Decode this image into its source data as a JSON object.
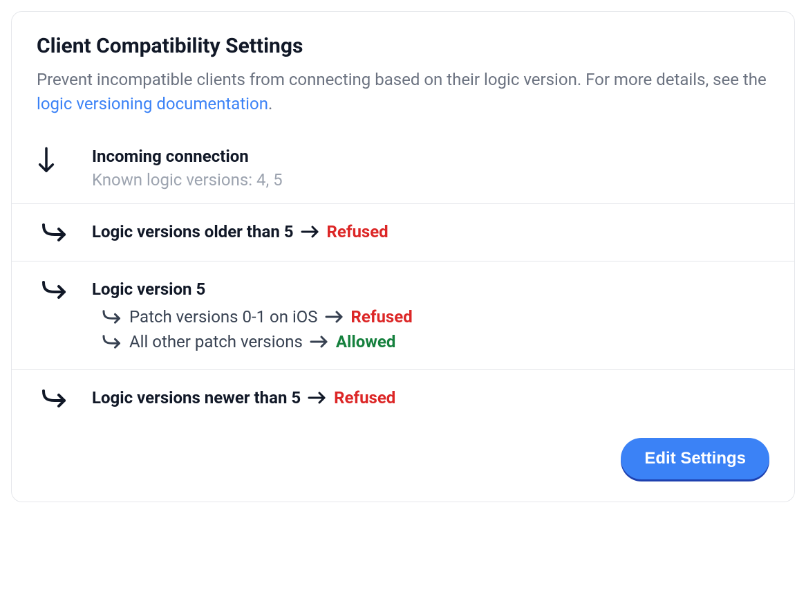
{
  "header": {
    "title": "Client Compatibility Settings",
    "description_prefix": "Prevent incompatible clients from connecting based on their logic version. For more details, see the ",
    "description_link": "logic versioning documentation",
    "description_suffix": "."
  },
  "incoming": {
    "title": "Incoming connection",
    "subtitle": "Known logic versions: 4, 5"
  },
  "rules": {
    "older": {
      "label": "Logic versions older than 5",
      "status": "Refused"
    },
    "current": {
      "label": "Logic version 5",
      "sub": [
        {
          "label": "Patch versions 0-1 on iOS",
          "status": "Refused"
        },
        {
          "label": "All other patch versions",
          "status": "Allowed"
        }
      ]
    },
    "newer": {
      "label": "Logic versions newer than 5",
      "status": "Refused"
    }
  },
  "footer": {
    "edit_button": "Edit Settings"
  },
  "colors": {
    "refused": "#dc2626",
    "allowed": "#15803d",
    "link": "#3b82f6",
    "muted": "#6b7280"
  }
}
